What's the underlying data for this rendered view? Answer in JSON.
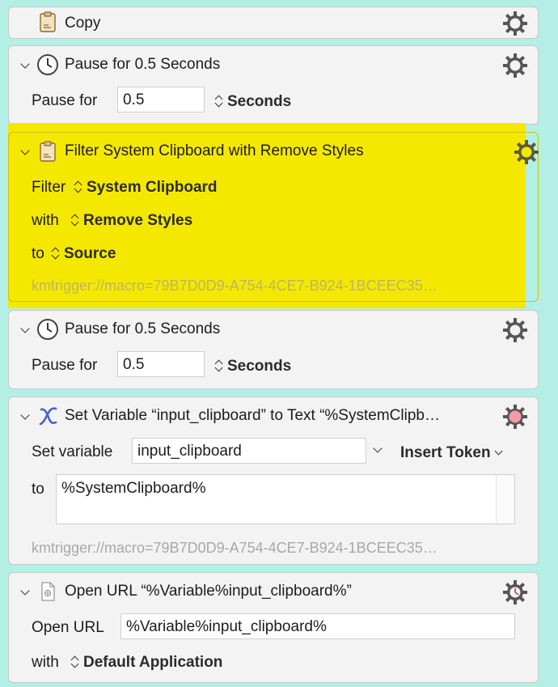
{
  "actions": [
    {
      "title": "Copy"
    },
    {
      "title": "Pause for 0.5 Seconds",
      "label": "Pause for",
      "value": "0.5",
      "unit": "Seconds"
    },
    {
      "title": "Filter System Clipboard with Remove Styles",
      "filter_label": "Filter",
      "filter_value": "System Clipboard",
      "with_label": "with",
      "with_value": "Remove Styles",
      "to_label": "to",
      "to_value": "Source",
      "url": "kmtrigger://macro=79B7D0D9-A754-4CE7-B924-1BCEEC35…"
    },
    {
      "title": "Pause for 0.5 Seconds",
      "label": "Pause for",
      "value": "0.5",
      "unit": "Seconds"
    },
    {
      "title": "Set Variable “input_clipboard” to Text “%SystemClipb…",
      "var_label": "Set variable",
      "var_value": "input_clipboard",
      "insert_token": "Insert Token",
      "to_label": "to",
      "text_value": "%SystemClipboard%",
      "url": "kmtrigger://macro=79B7D0D9-A754-4CE7-B924-1BCEEC35…"
    },
    {
      "title": "Open URL “%Variable%input_clipboard%”",
      "open_label": "Open URL",
      "open_value": "%Variable%input_clipboard%",
      "with_label": "with",
      "with_value": "Default Application"
    }
  ],
  "colors": {
    "background": "#b4efe6",
    "highlight": "#f5e800",
    "gear": "#555555",
    "gear_alert": "#f29aa8"
  }
}
